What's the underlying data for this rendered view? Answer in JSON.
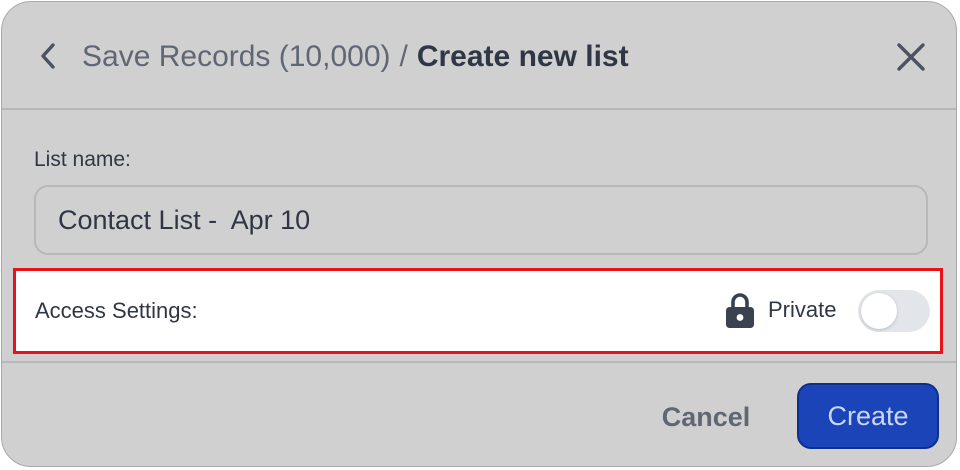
{
  "header": {
    "parent_title": "Save Records (10,000)",
    "separator": "/",
    "title": "Create new list",
    "back_icon": "chevron-left-icon",
    "close_icon": "close-icon"
  },
  "form": {
    "list_name_label": "List name:",
    "list_name_value": "Contact List -  Apr 10",
    "access_settings_label": "Access Settings:",
    "privacy_icon": "lock-icon",
    "privacy_label": "Private",
    "private_enabled": false
  },
  "footer": {
    "cancel_label": "Cancel",
    "create_label": "Create"
  },
  "colors": {
    "primary": "#1a44b8",
    "highlight": "#e8121b",
    "text_dark": "#2f3746",
    "text_muted": "#5f6774"
  }
}
